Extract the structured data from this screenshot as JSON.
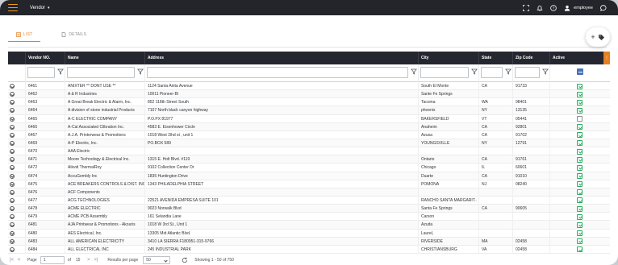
{
  "topbar": {
    "app_label": "Vendor",
    "user_name": "employee",
    "accent_color": "#f39c12"
  },
  "tabs": [
    {
      "label": "LIST",
      "active": true
    },
    {
      "label": "DETAILS",
      "active": false
    }
  ],
  "fab": {
    "plus": "+",
    "icon": "tag-icon"
  },
  "columns": [
    "",
    "Vendor NO.",
    "Name",
    "Address",
    "City",
    "State",
    "Zip Code",
    "Active"
  ],
  "rows": [
    {
      "no": "6461",
      "name": "ANIXTER ** DONT USE **",
      "address": "1124 Santa Anita Avenue",
      "city": "South El Monte",
      "state": "CA",
      "zip": "91733",
      "active": true
    },
    {
      "no": "6462",
      "name": "A & R Industries",
      "address": "10011 Pioneer Bl",
      "city": "Sante Fe Springs",
      "state": "",
      "zip": "",
      "active": true
    },
    {
      "no": "6463",
      "name": "A Great Break Electric & Alarm, Inc.",
      "address": "852 118th Street South",
      "city": "Tacoma",
      "state": "WA",
      "zip": "98401",
      "active": true
    },
    {
      "no": "6464",
      "name": "A division of stone industrial Products",
      "address": "7107 North black canyon highway",
      "city": "phoenix",
      "state": "NY",
      "zip": "13135",
      "active": true
    },
    {
      "no": "6465",
      "name": "A-C ELECTRIC COMPANY",
      "address": "P.O.PX 81977",
      "city": "BAKERSFIELD",
      "state": "VT",
      "zip": "05441",
      "active": false
    },
    {
      "no": "6466",
      "name": "A-Cal Associated Cilbration Inc.",
      "address": "4583 E. Eisenhower Circle",
      "city": "Anaheim",
      "state": "CA",
      "zip": "92801",
      "active": true
    },
    {
      "no": "6467",
      "name": "A.J.A. Printerwear & Promotions",
      "address": "1018 West 2ihd st , unit 1",
      "city": "Azusa",
      "state": "CA",
      "zip": "91702",
      "active": true
    },
    {
      "no": "6469",
      "name": "A-P Electric, Inc.",
      "address": "PO.BOX 589",
      "city": "YOUNGSVILLE",
      "state": "NY",
      "zip": "12791",
      "active": true
    },
    {
      "no": "6470",
      "name": "AAA Electric",
      "address": "",
      "city": "",
      "state": "",
      "zip": "",
      "active": true
    },
    {
      "no": "6471",
      "name": "Moore Technology & Electrical Inc.",
      "address": "1315 E. Holt Blvd. #119",
      "city": "Ontario",
      "state": "CA",
      "zip": "91761",
      "active": true
    },
    {
      "no": "6472",
      "name": "Aikvid ThermalRoy",
      "address": "9102 Collection Center Dr",
      "city": "Chicago",
      "state": "IL",
      "zip": "60601",
      "active": true
    },
    {
      "no": "6474",
      "name": "AccuGembly Inc",
      "address": "1835 Huntington Drive",
      "city": "Duarte",
      "state": "CA",
      "zip": "91010",
      "active": true
    },
    {
      "no": "6475",
      "name": "ACE BREAKERS CONTROLS & DIST. INC",
      "address": "1343 PHILADELPHIA STREET",
      "city": "POMONA",
      "state": "NJ",
      "zip": "08240",
      "active": true
    },
    {
      "no": "6476",
      "name": "ACF Components",
      "address": "",
      "city": "",
      "state": "",
      "zip": "",
      "active": true
    },
    {
      "no": "6477",
      "name": "ACG TECHNOLOGIES",
      "address": "22521 AVENIDA EMPRESA SUITE 101",
      "city": "RANCHO SANTA MARGARIT..",
      "state": "",
      "zip": "",
      "active": true
    },
    {
      "no": "6478",
      "name": "ACME ELECTRIC",
      "address": "9023 Norwalk Blvd",
      "city": "Santa Fe Springs",
      "state": "CA",
      "zip": "90605",
      "active": true
    },
    {
      "no": "6479",
      "name": "ACME PCB Assembly",
      "address": "161 Selandia Lane",
      "city": "Carson",
      "state": "",
      "zip": "",
      "active": true
    },
    {
      "no": "6481",
      "name": "AJA Printwear & Promotions - Akouris",
      "address": "1018 W 3rd St., Unit 1",
      "city": "Azuda",
      "state": "",
      "zip": "",
      "active": true
    },
    {
      "no": "6480",
      "name": "AES Electrical, Inc.",
      "address": "13305 Mid Atlantic Blvd.",
      "city": "Laurel,",
      "state": "",
      "zip": "",
      "active": true
    },
    {
      "no": "6483",
      "name": "ALL AMERICAN ELECTRICITY",
      "address": "3410 LA SIERRA F180951-315-9766",
      "city": "RIVERSIDE",
      "state": "MA",
      "zip": "02458",
      "active": true
    },
    {
      "no": "6484",
      "name": "ALL ELECTRICAL INC",
      "address": "245 INDUSTRIAL PARK",
      "city": "CHRISTIANSBURG",
      "state": "VA",
      "zip": "02458",
      "active": true
    }
  ],
  "pager": {
    "page_label": "Page",
    "page_value": "1",
    "of_label": "of",
    "total_pages": "15",
    "per_page_label": "Results per page",
    "per_page_value": "50",
    "showing": "Showing 1 - 50 of 750"
  }
}
